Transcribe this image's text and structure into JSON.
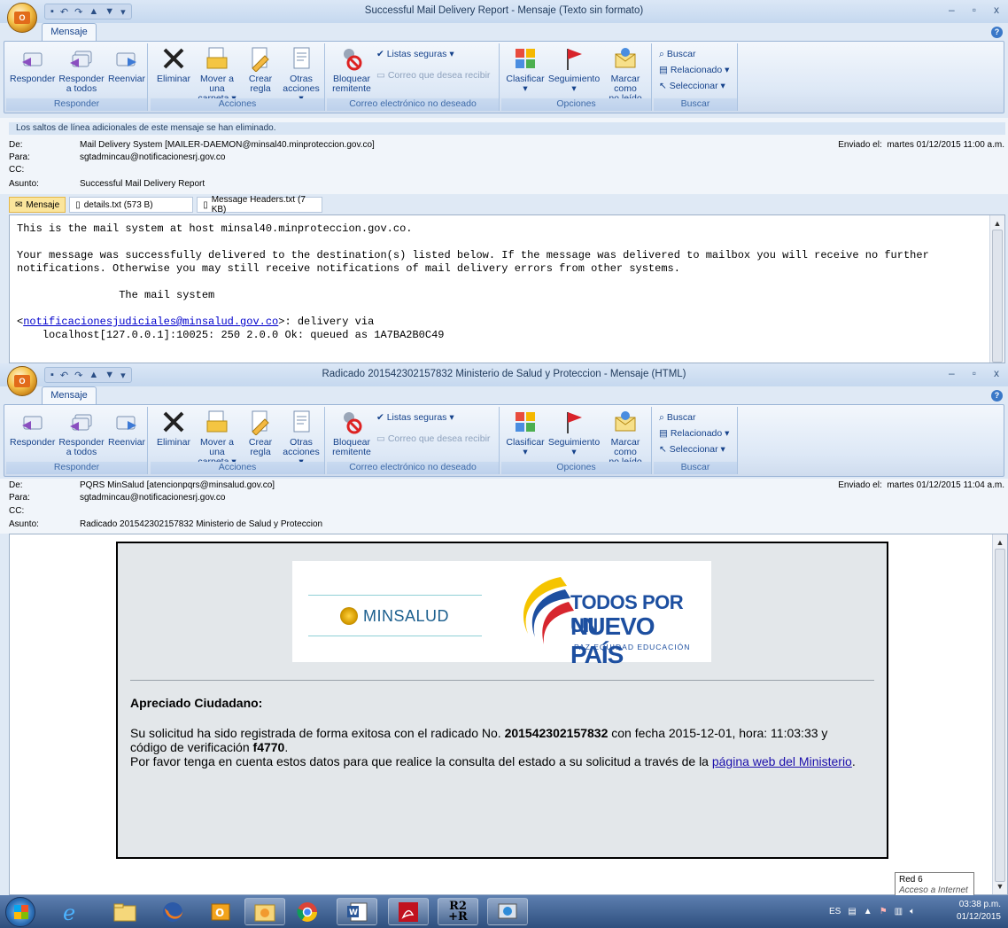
{
  "colors": {
    "ribbon_label": "#3e6aa8",
    "tab_text": "#15428b",
    "link": "#1a0dab",
    "taskbar": "#2e4f7e"
  },
  "window1": {
    "title": "Successful Mail Delivery Report - Mensaje (Texto sin formato)",
    "tab": "Mensaje",
    "notice": "Los saltos de línea adicionales de este mensaje se han eliminado.",
    "from_label": "De:",
    "from": "Mail Delivery System [MAILER-DAEMON@minsal40.minproteccion.gov.co]",
    "to_label": "Para:",
    "to": "sgtadmincau@notificacionesrj.gov.co",
    "cc_label": "CC:",
    "subject_label": "Asunto:",
    "subject": "Successful Mail Delivery Report",
    "sent_label": "Enviado el:",
    "sent": "martes 01/12/2015 11:00 a.m.",
    "attachments": [
      "Mensaje",
      "details.txt (573 B)",
      "Message Headers.txt (7 KB)"
    ],
    "body_line1": "This is the mail system at host minsal40.minproteccion.gov.co.",
    "body_line2": "Your message was successfully delivered to the destination(s) listed below. If the message was delivered to mailbox you will receive no further",
    "body_line3": "notifications. Otherwise you may still receive notifications of mail delivery errors from other systems.",
    "body_line4": "The mail system",
    "body_addr": "notificacionesjudiciales@minsalud.gov.co",
    "body_via": ">: delivery via",
    "body_line6": "localhost[127.0.0.1]:10025: 250 2.0.0 Ok: queued as 1A7BA2B0C49"
  },
  "window2": {
    "title": "Radicado 201542302157832 Ministerio de Salud y Proteccion - Mensaje (HTML)",
    "tab": "Mensaje",
    "from_label": "De:",
    "from": "PQRS MinSalud [atencionpqrs@minsalud.gov.co]",
    "to_label": "Para:",
    "to": "sgtadmincau@notificacionesrj.gov.co",
    "cc_label": "CC:",
    "subject_label": "Asunto:",
    "subject": "Radicado 201542302157832 Ministerio de Salud y Proteccion",
    "sent_label": "Enviado el:",
    "sent": "martes 01/12/2015 11:04 a.m.",
    "logo_left": "MINSALUD",
    "logo_right1": "TODOS POR UN",
    "logo_right2": "NUEVO PAÍS",
    "logo_right3": "PAZ  EQUIDAD  EDUCACIÓN",
    "greeting": "Apreciado Ciudadano:",
    "p1_a": "Su solicitud ha sido registrada de forma exitosa con el radicado No. ",
    "p1_num": "201542302157832",
    "p1_b": " con fecha 2015-12-01, hora: 11:03:33 y",
    "p2_a": "código de verificación ",
    "p2_code": "f4770",
    "p2_b": ".",
    "p3_a": "Por favor tenga en cuenta estos datos para que realice la consulta del estado a su solicitud a través de la ",
    "p3_link": "página web del Ministerio",
    "p3_b": "."
  },
  "ribbon": {
    "responder": "Responder",
    "responder_todos_1": "Responder",
    "responder_todos_2": "a todos",
    "reenviar": "Reenviar",
    "eliminar": "Eliminar",
    "mover_1": "Mover a una",
    "mover_2": "carpeta ▾",
    "crear_1": "Crear",
    "crear_2": "regla",
    "otras_1": "Otras",
    "otras_2": "acciones ▾",
    "bloquear_1": "Bloquear",
    "bloquear_2": "remitente",
    "listas": "Listas seguras ▾",
    "correo_deseado": "Correo que desea recibir",
    "clasificar": "Clasificar",
    "seguimiento": "Seguimiento",
    "marcar_1": "Marcar como",
    "marcar_2": "no leído",
    "buscar": "Buscar",
    "relacionado": "Relacionado ▾",
    "seleccionar": "Seleccionar ▾",
    "g_responder": "Responder",
    "g_acciones": "Acciones",
    "g_correo": "Correo electrónico no deseado",
    "g_opciones": "Opciones",
    "g_buscar": "Buscar"
  },
  "tooltip": {
    "line1": "Red 6",
    "line2": "Acceso a Internet"
  },
  "taskbar": {
    "lang": "ES",
    "time": "03:38 p.m.",
    "date": "01/12/2015",
    "r2_top": "R2",
    "r2_bot": "+R"
  }
}
